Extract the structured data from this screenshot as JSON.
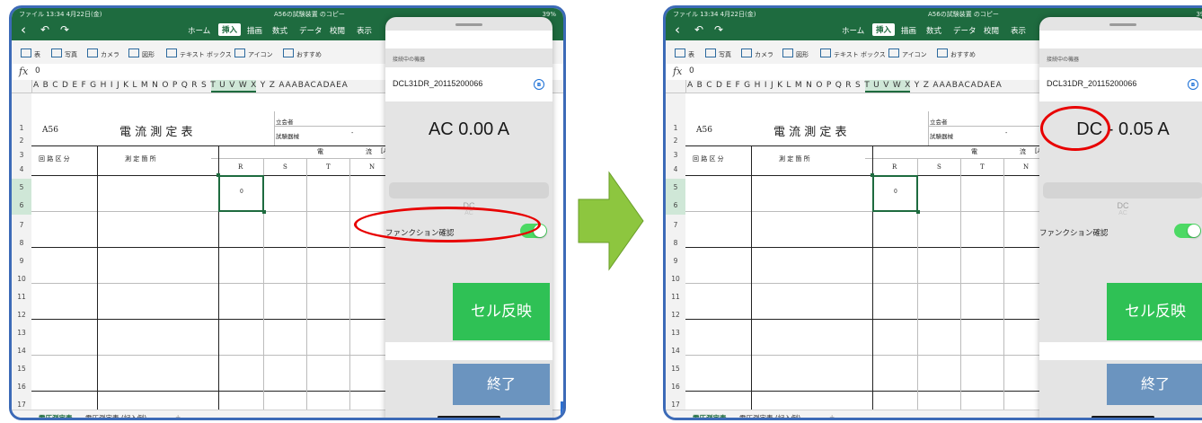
{
  "excel": {
    "status_time": "ファイル 13:34 4月22日(金)",
    "window_title": "A56の試験装置 のコピー",
    "battery": "39%",
    "ribbon_tabs": [
      "ホーム",
      "挿入",
      "描画",
      "数式",
      "データ",
      "校閲",
      "表示"
    ],
    "active_tab": "挿入",
    "tools": [
      "表",
      "写真",
      "カメラ",
      "図形",
      "テキスト ボックス",
      "アイコン",
      "おすすめ"
    ],
    "formula_value": "0",
    "column_letters": "A B C D E F G H I J K L M N O P Q R S T U V W X Y Z AAABACADAEA",
    "row_numbers": [
      "1",
      "2",
      "3",
      "4",
      "5",
      "6",
      "7",
      "8",
      "9",
      "10",
      "11",
      "12",
      "13",
      "14",
      "15",
      "16",
      "17"
    ],
    "sheet": {
      "code": "A56",
      "title": "電 流 測 定 表",
      "witness": "立会者",
      "test_device": "試験器械",
      "circuit_section": "回 路 区 分",
      "measuring_point": "測 定 箇 所",
      "current_header": "電",
      "current_header2": "流",
      "unit": "[A]",
      "phase_r": "R",
      "phase_s": "S",
      "phase_t": "T",
      "phase_n": "N",
      "cell_value": "0",
      "dash": "-"
    },
    "sheet_tabs": [
      "電圧測定表",
      "電圧測定表 (記入例)",
      "+"
    ]
  },
  "panel": {
    "connecting_label": "接続中の機器",
    "device_name": "DCL31DR_20115200066",
    "function_confirm_label": "ファンクション確認",
    "reflect_button": "セル反映",
    "end_button": "終了"
  },
  "states": {
    "before": {
      "reading": "AC 0.00 A",
      "mode_text": "DC",
      "mode_faint": "AC"
    },
    "after": {
      "reading": "DC - 0.05 A",
      "mode_text": "DC",
      "mode_faint": "AC"
    }
  },
  "colors": {
    "excel_green": "#1e6b3f",
    "toggle_on": "#4cd964",
    "reflect_button": "#2fc155",
    "end_button": "#6b94bf",
    "annotation_red": "#e80000",
    "arrow_green": "#8dc63f"
  }
}
